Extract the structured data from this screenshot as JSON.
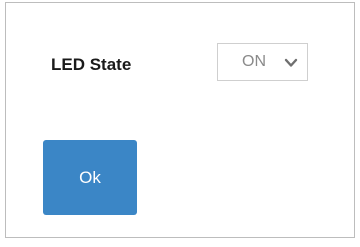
{
  "form": {
    "led_state_label": "LED State",
    "led_state_select": {
      "selected_value": "ON"
    },
    "ok_button_label": "Ok"
  },
  "colors": {
    "button_bg": "#3b86c6",
    "button_text": "#ffffff",
    "select_text": "#8a8a8a",
    "panel_border": "#bdbdbd"
  },
  "icons": {
    "dropdown": "chevron-down-icon"
  }
}
